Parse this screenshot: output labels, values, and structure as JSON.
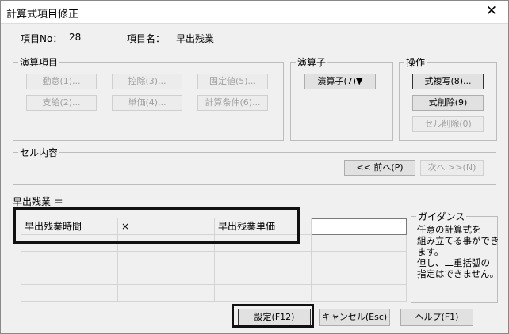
{
  "window": {
    "title": "計算式項目修正",
    "close_glyph": "✕"
  },
  "item_info": {
    "no_label": "項目No：",
    "no_value": "28",
    "name_label": "項目名：",
    "name_value": "早出残業"
  },
  "groups": {
    "calc_items": {
      "legend": "演算項目",
      "buttons": [
        "勤怠(1)...",
        "控除(3)...",
        "固定値(5)...",
        "支給(2)...",
        "単価(4)...",
        "計算条件(6)..."
      ]
    },
    "operator": {
      "legend": "演算子",
      "button": "演算子(7)▼"
    },
    "operation": {
      "legend": "操作",
      "copy": "式複写(8)...",
      "delete": "式削除(9)",
      "cell_delete": "セル削除(0)"
    },
    "cell_content": {
      "legend": "セル内容",
      "prev": "<< 前へ(P)",
      "next": "次へ >>(N)"
    }
  },
  "formula": {
    "label": "早出残業 ＝",
    "row1": [
      "早出残業時間",
      "×",
      "早出残業単価",
      ""
    ]
  },
  "guidance": {
    "legend": "ガイダンス",
    "lines": [
      "任意の計算式を",
      "組み立てる事ができます。",
      "但し、二重括弧の",
      "指定はできません。"
    ]
  },
  "footer": {
    "ok": "設定(F12)",
    "cancel": "キャンセル(Esc)",
    "help": "ヘルプ(F1)"
  }
}
